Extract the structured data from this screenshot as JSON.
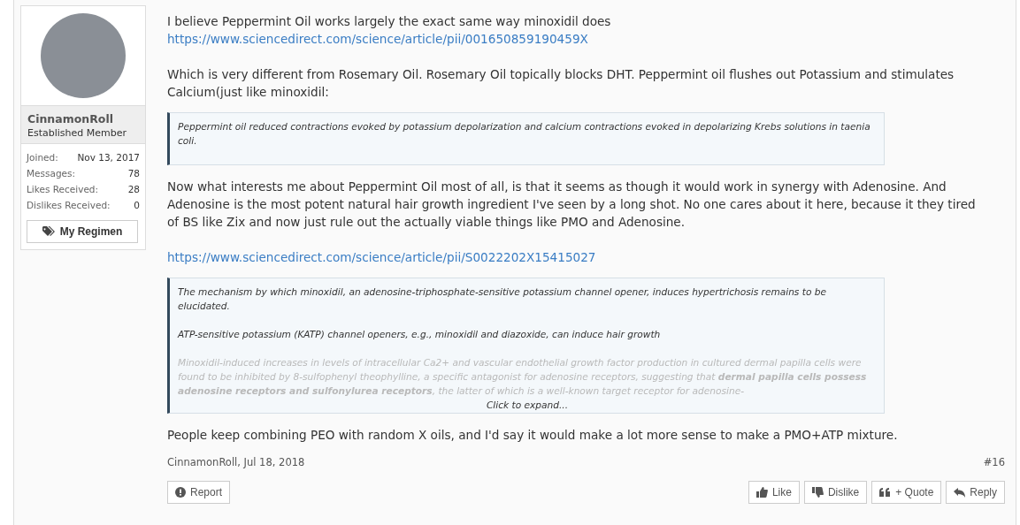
{
  "user": {
    "name": "CinnamonRoll",
    "title": "Established Member",
    "stats": [
      {
        "label": "Joined:",
        "value": "Nov 13, 2017"
      },
      {
        "label": "Messages:",
        "value": "78"
      },
      {
        "label": "Likes Received:",
        "value": "28"
      },
      {
        "label": "Dislikes Received:",
        "value": "0"
      }
    ],
    "regimen_button": "My Regimen"
  },
  "message": [
    {
      "kind": "text",
      "text": "I believe Peppermint Oil works largely the exact same way minoxidil does"
    },
    {
      "kind": "link",
      "text": "https://www.sciencedirect.com/science/article/pii/001650859190459X"
    },
    {
      "kind": "gap"
    },
    {
      "kind": "text",
      "text": "Which is very different from Rosemary Oil. Rosemary Oil topically blocks DHT. Peppermint oil flushes out Potassium and stimulates Calcium(just like minoxidil:"
    },
    {
      "kind": "quote",
      "paragraphs": [
        {
          "text": "Peppermint oil reduced contractions evoked by potassium depolarization and calcium contractions evoked in depolarizing Krebs solutions in taenia coli.",
          "faded": false
        }
      ]
    },
    {
      "kind": "text",
      "text": "Now what interests me about Peppermint Oil most of all, is that it seems as though it would work in synergy with Adenosine. And Adenosine is the most potent natural hair growth ingredient I've seen by a long shot. No one cares about it here, because it they tired of BS like Zix and now just rule out the actually viable things like PMO and Adenosine."
    },
    {
      "kind": "gap"
    },
    {
      "kind": "link",
      "text": "https://www.sciencedirect.com/science/article/pii/S0022202X15415027"
    },
    {
      "kind": "quote",
      "paragraphs": [
        {
          "text": "The mechanism by which minoxidil, an adenosine-triphosphate-sensitive potassium channel opener, induces hypertrichosis remains to be elucidated.",
          "faded": false
        },
        {
          "text": "ATP-sensitive potassium (KATP) channel openers, e.g., minoxidil and diazoxide, can induce hair growth",
          "faded": false
        },
        {
          "text": "Minoxidil-induced increases in levels of intracellular Ca2+ and vascular endothelial growth factor production in cultured dermal papilla cells were found to be inhibited by 8-sulfophenyl theophylline, a specific antagonist for adenosine receptors, suggesting that **dermal papilla cells possess adenosine receptors and sulfonylurea receptors**, the latter of which is a well-known target receptor for adenosine-",
          "faded": true
        }
      ],
      "expand": "Click to expand..."
    },
    {
      "kind": "text",
      "text": "People keep combining PEO with random X oils, and I'd say it would make a lot more sense to make a PMO+ATP mixture."
    }
  ],
  "footer": {
    "byline": "CinnamonRoll, Jul 18, 2018",
    "post_number": "#16",
    "report": "Report",
    "actions": [
      {
        "kind": "like",
        "label": "Like"
      },
      {
        "kind": "dislike",
        "label": "Dislike"
      },
      {
        "kind": "quote",
        "label": "+ Quote"
      },
      {
        "kind": "reply",
        "label": "Reply"
      }
    ]
  }
}
